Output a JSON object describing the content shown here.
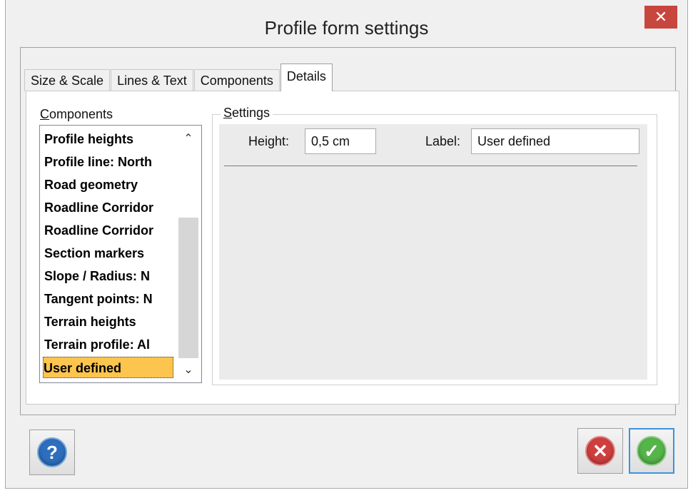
{
  "window": {
    "title": "Profile form settings",
    "close_symbol": "✕"
  },
  "tabs": [
    {
      "label": "Size & Scale",
      "active": false
    },
    {
      "label": "Lines & Text",
      "active": false
    },
    {
      "label": "Components",
      "active": false
    },
    {
      "label": "Details",
      "active": true
    }
  ],
  "components": {
    "label": "Components",
    "items": [
      "Profile heights",
      "Profile line: North",
      "Road geometry",
      "Roadline Corridor",
      "Roadline Corridor",
      "Section markers",
      "Slope / Radius: N",
      "Tangent points: N",
      "Terrain heights",
      "Terrain profile: Al",
      "User defined"
    ],
    "selected_index": 10,
    "scroll_up": "⌃",
    "scroll_down": "⌄"
  },
  "settings": {
    "label": "Settings",
    "height_label": "Height:",
    "height_value": "0,5 cm",
    "label_label": "Label:",
    "label_value": "User defined"
  },
  "buttons": {
    "help_symbol": "?",
    "cancel_symbol": "✕",
    "ok_symbol": "✓"
  },
  "colors": {
    "close": "#c7463d",
    "selection": "#fec54e",
    "focus_border": "#3b93e0"
  }
}
